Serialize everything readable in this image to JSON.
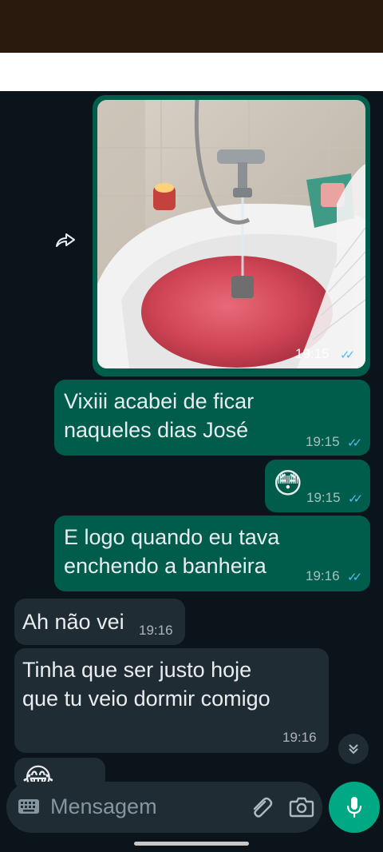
{
  "messages": {
    "image_msg": {
      "time": "19:15",
      "ticks": "✓✓"
    },
    "msg1": {
      "line1": "Vixiii acabei de ficar",
      "line2": "naqueles dias José",
      "time": "19:15",
      "ticks": "✓✓"
    },
    "msg2": {
      "emoji": "😳",
      "time": "19:15",
      "ticks": "✓✓"
    },
    "msg3": {
      "line1": "E logo quando eu tava",
      "line2": "enchendo a banheira",
      "time": "19:16",
      "ticks": "✓✓"
    },
    "msg4": {
      "text": "Ah não vei",
      "time": "19:16"
    },
    "msg5": {
      "line1": "Tinha que ser justo hoje",
      "line2": "que tu veio dormir comigo",
      "time": "19:16"
    },
    "msg6": {
      "emoji": "😂"
    }
  },
  "forward_icon": "forward-icon",
  "scroll_icon": "chevron-double-down-icon",
  "composer": {
    "placeholder": "Mensagem"
  },
  "colors": {
    "outgoing": "#005c4b",
    "incoming": "#202c33",
    "background": "#0b141a",
    "accent": "#00a884",
    "read_ticks": "#53bdeb"
  }
}
